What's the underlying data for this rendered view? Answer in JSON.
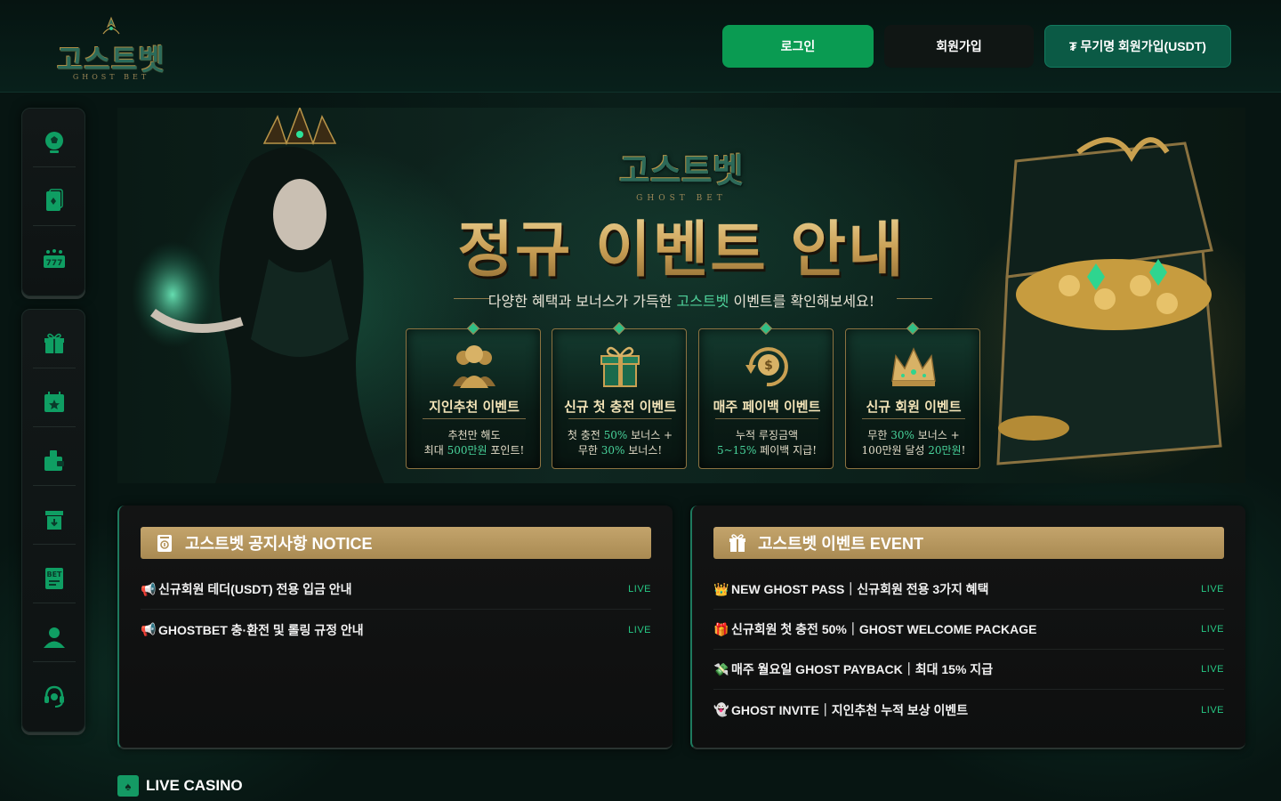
{
  "brand": {
    "logo_text": "고스트벳",
    "logo_sub": "GHOST BET",
    "accent": "#0a9b52",
    "gold": "#c3a46c"
  },
  "header": {
    "login_label": "로그인",
    "join_label": "회원가입",
    "usdt_join_label": "₮ 무기명 회원가입(USDT)"
  },
  "sidebar": {
    "groups": [
      {
        "items": [
          {
            "icon": "soccer-ball-icon"
          },
          {
            "icon": "playing-card-icon"
          },
          {
            "icon": "slot-777-icon"
          }
        ]
      },
      {
        "items": [
          {
            "icon": "gift-icon"
          },
          {
            "icon": "calendar-star-icon"
          },
          {
            "icon": "wallet-deposit-icon"
          },
          {
            "icon": "withdraw-box-icon"
          },
          {
            "icon": "bet-slip-icon"
          },
          {
            "icon": "user-icon"
          },
          {
            "icon": "headset-support-icon"
          }
        ]
      }
    ]
  },
  "banner": {
    "logo_text": "고스트벳",
    "logo_sub": "GHOST BET",
    "title": "정규 이벤트 안내",
    "subtitle_pre": "다양한 혜택과 보너스가 가득한 ",
    "subtitle_highlight": "고스트벳",
    "subtitle_post": " 이벤트를 확인해보세요!",
    "cards": [
      {
        "icon": "people-icon",
        "title": "지인추천 이벤트",
        "line1": "추천만 해도",
        "line2_pre": "최대 ",
        "line2_hl": "500만원",
        "line2_post": " 포인트!"
      },
      {
        "icon": "gift-box-icon",
        "title": "신규 첫 충전 이벤트",
        "line1_pre": "첫 충전 ",
        "line1_hl": "50%",
        "line1_post": " 보너스 +",
        "line2_pre": "무한 ",
        "line2_hl": "30%",
        "line2_post": " 보너스!"
      },
      {
        "icon": "payback-coin-icon",
        "title": "매주 페이백 이벤트",
        "line1": "누적 루징금액",
        "line2_hl": "5~15%",
        "line2_post": " 페이백 지급!"
      },
      {
        "icon": "crown-icon",
        "title": "신규 회원 이벤트",
        "line1_pre": "무한 ",
        "line1_hl": "30%",
        "line1_post": " 보너스 +",
        "line2_pre": "100만원 달성 ",
        "line2_hl": "20만원",
        "line2_post": "!"
      }
    ]
  },
  "notice": {
    "title": "고스트벳 공지사항 NOTICE",
    "rows": [
      {
        "emoji": "📢",
        "text": "신규회원 테더(USDT) 전용 입금 안내",
        "badge": "LIVE"
      },
      {
        "emoji": "📢",
        "text": "GHOSTBET 충·환전 및 롤링 규정 안내",
        "badge": "LIVE"
      }
    ]
  },
  "events": {
    "title": "고스트벳 이벤트 EVENT",
    "rows": [
      {
        "emoji": "👑",
        "text": "NEW GHOST PASS｜신규회원 전용 3가지 혜택",
        "badge": "LIVE"
      },
      {
        "emoji": "🎁",
        "text": "신규회원 첫 충전 50%｜GHOST WELCOME PACKAGE",
        "badge": "LIVE"
      },
      {
        "emoji": "💸",
        "text": "매주 월요일 GHOST PAYBACK｜최대 15% 지급",
        "badge": "LIVE"
      },
      {
        "emoji": "👻",
        "text": "GHOST INVITE｜지인추천 누적 보상 이벤트",
        "badge": "LIVE"
      }
    ]
  },
  "live_casino": {
    "icon": "spade-icon",
    "title": "LIVE CASINO"
  }
}
